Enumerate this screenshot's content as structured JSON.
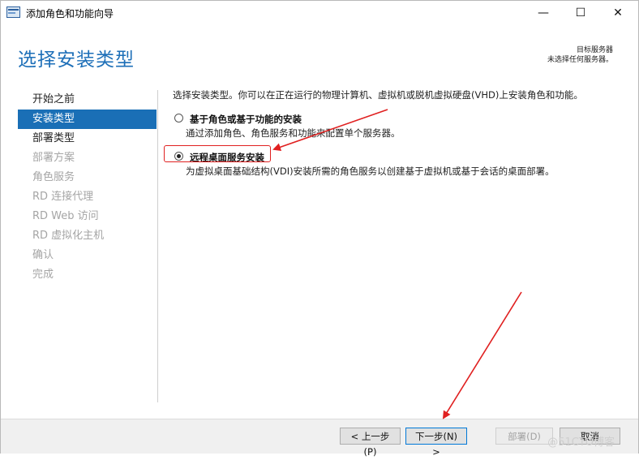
{
  "window": {
    "title": "添加角色和功能向导",
    "minimize_symbol": "—",
    "maximize_symbol": "☐",
    "close_symbol": "✕"
  },
  "page": {
    "title": "选择安装类型",
    "destination_label": "目标服务器",
    "destination_value": "未选择任何服务器。"
  },
  "nav": {
    "items": [
      {
        "label": "开始之前",
        "state": "done"
      },
      {
        "label": "安装类型",
        "state": "active"
      },
      {
        "label": "部署类型",
        "state": "done"
      },
      {
        "label": "部署方案",
        "state": "disabled"
      },
      {
        "label": "角色服务",
        "state": "disabled"
      },
      {
        "label": "RD 连接代理",
        "state": "disabled"
      },
      {
        "label": "RD Web 访问",
        "state": "disabled"
      },
      {
        "label": "RD 虚拟化主机",
        "state": "disabled"
      },
      {
        "label": "确认",
        "state": "disabled"
      },
      {
        "label": "完成",
        "state": "disabled"
      }
    ]
  },
  "content": {
    "intro": "选择安装类型。你可以在正在运行的物理计算机、虚拟机或脱机虚拟硬盘(VHD)上安装角色和功能。",
    "options": [
      {
        "label": "基于角色或基于功能的安装",
        "description": "通过添加角色、角色服务和功能来配置单个服务器。",
        "selected": false
      },
      {
        "label": "远程桌面服务安装",
        "description": "为虚拟桌面基础结构(VDI)安装所需的角色服务以创建基于虚拟机或基于会话的桌面部署。",
        "selected": true
      }
    ]
  },
  "footer": {
    "prev_label": "< 上一步(P)",
    "next_label": "下一步(N) >",
    "deploy_label": "部署(D)",
    "cancel_label": "取消"
  },
  "watermark": "@51CTO博客",
  "colors": {
    "accent": "#1a6fb6",
    "title": "#1d6fb8",
    "annotation": "#e02020"
  }
}
